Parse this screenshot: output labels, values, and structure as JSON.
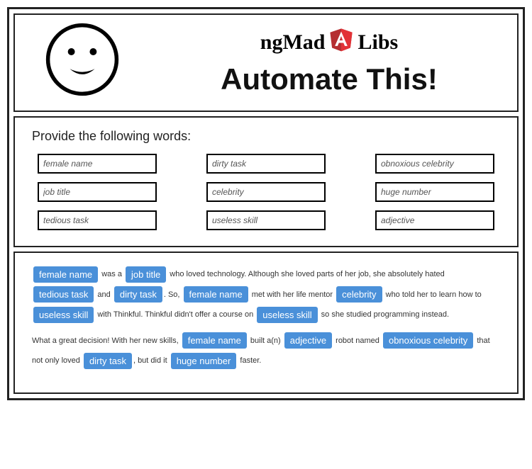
{
  "brand": {
    "pre": "ngMad",
    "post": "Libs"
  },
  "story_title": "Automate This!",
  "prompt": "Provide the following words:",
  "inputs": [
    {
      "key": "female_name",
      "placeholder": "female name"
    },
    {
      "key": "dirty_task",
      "placeholder": "dirty task"
    },
    {
      "key": "obnoxious_celebrity",
      "placeholder": "obnoxious celebrity"
    },
    {
      "key": "job_title",
      "placeholder": "job title"
    },
    {
      "key": "celebrity",
      "placeholder": "celebrity"
    },
    {
      "key": "huge_number",
      "placeholder": "huge number"
    },
    {
      "key": "tedious_task",
      "placeholder": "tedious task"
    },
    {
      "key": "useless_skill",
      "placeholder": "useless skill"
    },
    {
      "key": "adjective",
      "placeholder": "adjective"
    }
  ],
  "chips": {
    "female_name": "female name",
    "job_title": "job title",
    "tedious_task": "tedious task",
    "dirty_task": "dirty task",
    "celebrity": "celebrity",
    "useless_skill": "useless skill",
    "adjective": "adjective",
    "obnoxious_celebrity": "obnoxious celebrity",
    "huge_number": "huge number"
  },
  "story": {
    "t1": " was a ",
    "t2": " who loved technology. Although she loved parts of her job, she absolutely hated ",
    "t3": " and ",
    "t4": ". So, ",
    "t5": " met with her life mentor ",
    "t6": " who told her to learn how to ",
    "t7": " with Thinkful. Thinkful didn't offer a course on ",
    "t8": " so she studied programming instead.",
    "p2a": "What a great decision! With her new skills, ",
    "p2b": " built a(n) ",
    "p2c": " robot named ",
    "p2d": " that not only loved ",
    "p2e": ", but did it ",
    "p2f": " faster."
  }
}
